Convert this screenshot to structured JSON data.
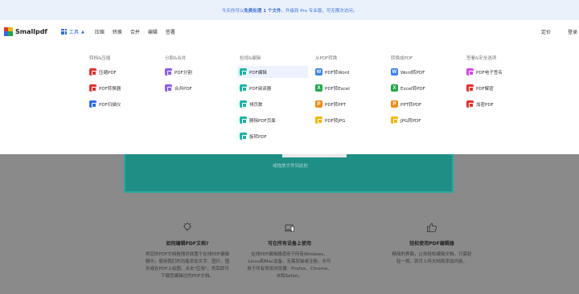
{
  "banner": {
    "prefix": "今天你可以",
    "bold": "免费处理 1 个文件",
    "suffix": "。升级到 Pro 专业版，可无限次访问。"
  },
  "nav": {
    "logo": "Smallpdf",
    "tools": "工具",
    "items": [
      "压缩",
      "转换",
      "合并",
      "编辑",
      "签署"
    ],
    "right": [
      "定价",
      "登录"
    ]
  },
  "menu": [
    {
      "title": "转档&压缩",
      "items": [
        {
          "label": "压缩PDF",
          "color": "#e5322d",
          "icon": "compress-icon"
        },
        {
          "label": "PDF转换器",
          "color": "#e5322d",
          "icon": "convert-icon"
        },
        {
          "label": "PDF扫描仪",
          "color": "#2f6bed",
          "icon": "scan-icon"
        }
      ]
    },
    {
      "title": "分割&合并",
      "items": [
        {
          "label": "PDF分割",
          "color": "#8b5cf6",
          "icon": "split-icon"
        },
        {
          "label": "合并PDF",
          "color": "#8b5cf6",
          "icon": "merge-icon"
        }
      ]
    },
    {
      "title": "检视&编辑",
      "items": [
        {
          "label": "PDF编辑",
          "color": "#14b8a6",
          "icon": "edit-icon",
          "active": true
        },
        {
          "label": "PDF阅读器",
          "color": "#14b8a6",
          "icon": "reader-icon"
        },
        {
          "label": "排页数",
          "color": "#14b8a6",
          "icon": "page-number-icon"
        },
        {
          "label": "删除PDF页面",
          "color": "#14b8a6",
          "icon": "delete-pages-icon"
        },
        {
          "label": "旋转PDF",
          "color": "#14b8a6",
          "icon": "rotate-icon"
        }
      ]
    },
    {
      "title": "从PDF转换",
      "items": [
        {
          "label": "PDF转Word",
          "color": "#3b82f6",
          "icon": "word-icon",
          "letter": "W"
        },
        {
          "label": "PDF转Excel",
          "color": "#22a84a",
          "icon": "excel-icon",
          "letter": "X"
        },
        {
          "label": "PDF转PPT",
          "color": "#f28c1b",
          "icon": "ppt-icon",
          "letter": "P"
        },
        {
          "label": "PDF转JPG",
          "color": "#f5b800",
          "icon": "jpg-icon"
        }
      ]
    },
    {
      "title": "转换成PDF",
      "items": [
        {
          "label": "Word转PDF",
          "color": "#3b82f6",
          "icon": "word-icon",
          "letter": "W"
        },
        {
          "label": "Excel转PDF",
          "color": "#22a84a",
          "icon": "excel-icon",
          "letter": "X"
        },
        {
          "label": "PPT转PDF",
          "color": "#f28c1b",
          "icon": "ppt-icon",
          "letter": "P"
        },
        {
          "label": "JPG转PDF",
          "color": "#f5b800",
          "icon": "jpg-icon"
        }
      ]
    },
    {
      "title": "签署&安全选项",
      "items": [
        {
          "label": "PDF电子签名",
          "color": "#d946ef",
          "icon": "sign-icon"
        },
        {
          "label": "PDF解密",
          "color": "#e5322d",
          "icon": "unlock-icon"
        },
        {
          "label": "加密PDF",
          "color": "#e5322d",
          "icon": "lock-icon"
        }
      ]
    }
  ],
  "upload": {
    "caption": "或拖放文件到此处"
  },
  "features": [
    {
      "title": "如何编辑PDF文档?",
      "icon": "lightbulb-icon",
      "lines": [
        "将您的PDF文档拖拽并放置于在线PDF编辑",
        "器中。使用我们的功能添加文字、图片、图",
        "形或在PDF上绘图。点击\"应用\"，然后即可",
        "下载您编辑过的PDF文档。"
      ]
    },
    {
      "title": "可在所有设备上使用",
      "icon": "devices-icon",
      "lines": [
        "在线PDF编辑器适用于所有Windows、",
        "Linux和Mac设备。无需安装或注册。亦可",
        "用于所有常用浏览器：Firefox、Chrome、",
        "IE和Safari。"
      ]
    },
    {
      "title": "轻松使用PDF编辑器",
      "icon": "thumbs-up-icon",
      "lines": [
        "精简的界面，让你轻松编辑文档。只需轻",
        "轻一按，就可上传文档和添加内容。"
      ]
    }
  ]
}
